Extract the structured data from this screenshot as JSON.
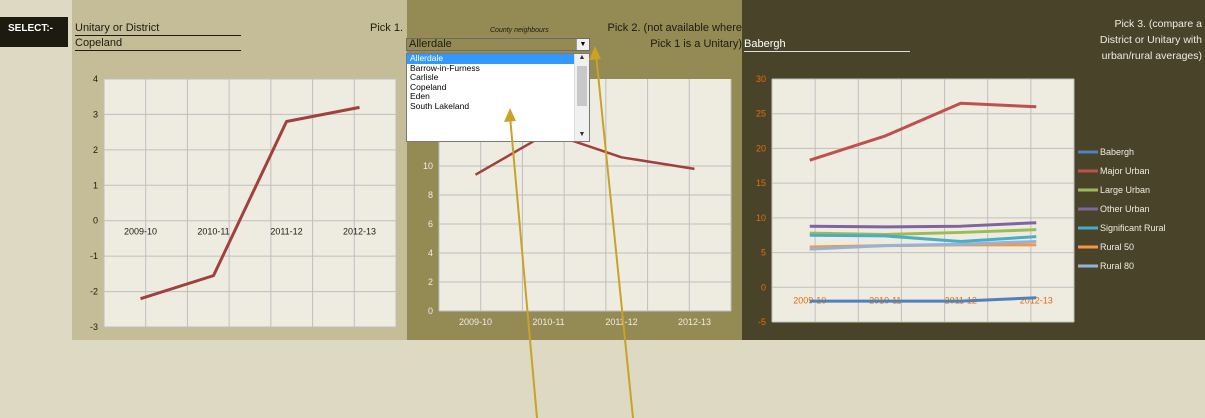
{
  "header": {
    "select_label": "SELECT:-",
    "field_label": "Unitary or District",
    "field_value": "Copeland",
    "pick1_label": "Pick 1.",
    "county_neighbours_label": "County neighbours",
    "dropdown_value": "Allerdale",
    "pick2_line1": "Pick 2. (not available where",
    "pick2_line2": "Pick 1 is a Unitary)",
    "pick2_value": "Babergh",
    "pick3_line1": "Pick 3. (compare a",
    "pick3_line2": "District or Unitary with",
    "pick3_line3": "urban/rural averages)"
  },
  "dropdown_options": [
    "Allerdale",
    "Barrow-in-Furness",
    "Carlisle",
    "Copeland",
    "Eden",
    "South Lakeland"
  ],
  "colors": {
    "chart_bg": "#eeece1",
    "grid": "#bfbfbf",
    "red": "#a0413c",
    "dark_text": "#1d1b10",
    "orange_text": "#e46c0a",
    "arrow": "#c9a227"
  },
  "chart_data": [
    {
      "type": "line",
      "categories": [
        "2009-10",
        "2010-11",
        "2011-12",
        "2012-13"
      ],
      "ylim": [
        -3,
        4
      ],
      "yticks": [
        "4",
        "3",
        "2",
        "1",
        "0",
        "-1",
        "-2",
        "-3"
      ],
      "series": [
        {
          "values": [
            -2.2,
            -1.55,
            2.8,
            3.2
          ],
          "color": "#a0413c"
        }
      ]
    },
    {
      "type": "line",
      "categories": [
        "2009-10",
        "2010-11",
        "2011-12",
        "2012-13"
      ],
      "ylim": [
        0,
        16
      ],
      "yticks": [
        "10",
        "8",
        "6",
        "4",
        "2",
        "0"
      ],
      "series": [
        {
          "values": [
            9.4,
            12.3,
            10.6,
            9.8
          ],
          "color": "#a0413c"
        }
      ]
    },
    {
      "type": "line",
      "categories": [
        "2009-10",
        "2010-11",
        "2011-12",
        "2012-13"
      ],
      "ylim": [
        -5,
        30
      ],
      "yticks": [
        "30",
        "25",
        "20",
        "15",
        "10",
        "5",
        "0",
        "-5"
      ],
      "legend_position": "right",
      "series": [
        {
          "name": "Babergh",
          "color": "#4f81bd",
          "values": [
            -2,
            -2,
            -2,
            -1.5
          ]
        },
        {
          "name": "Major Urban",
          "color": "#c0504d",
          "values": [
            18.3,
            21.8,
            26.5,
            26
          ]
        },
        {
          "name": "Large Urban",
          "color": "#9bbb59",
          "values": [
            7.8,
            7.6,
            7.9,
            8.3
          ]
        },
        {
          "name": "Other Urban",
          "color": "#8064a2",
          "values": [
            8.8,
            8.7,
            8.8,
            9.3
          ]
        },
        {
          "name": "Significant Rural",
          "color": "#4bacc6",
          "values": [
            7.5,
            7.4,
            6.6,
            7.3
          ]
        },
        {
          "name": "Rural 50",
          "color": "#f79646",
          "values": [
            5.8,
            6,
            6.1,
            6.1
          ]
        },
        {
          "name": "Rural 80",
          "color": "#95b3d7",
          "values": [
            5.5,
            6,
            6.2,
            6.6
          ]
        }
      ]
    }
  ]
}
